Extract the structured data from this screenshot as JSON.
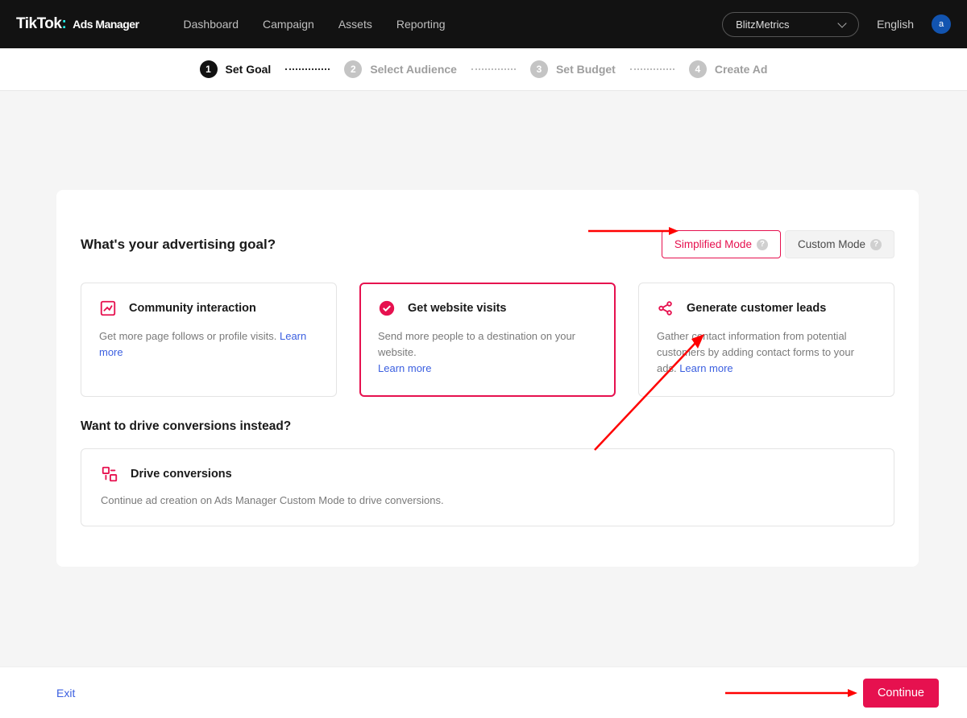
{
  "header": {
    "logo_main": "TikTok",
    "logo_colon": ":",
    "logo_sub": "Ads Manager",
    "nav": [
      "Dashboard",
      "Campaign",
      "Assets",
      "Reporting"
    ],
    "account": "BlitzMetrics",
    "language": "English",
    "avatar_letter": "a"
  },
  "steps": [
    {
      "num": "1",
      "label": "Set Goal",
      "active": true
    },
    {
      "num": "2",
      "label": "Select Audience",
      "active": false
    },
    {
      "num": "3",
      "label": "Set Budget",
      "active": false
    },
    {
      "num": "4",
      "label": "Create Ad",
      "active": false
    }
  ],
  "main": {
    "question": "What's your advertising goal?",
    "mode_simplified": "Simplified Mode",
    "mode_custom": "Custom Mode",
    "goals": [
      {
        "title": "Community interaction",
        "desc": "Get more page follows or profile visits. ",
        "learn_more": "Learn more"
      },
      {
        "title": "Get website visits",
        "desc": "Send more people to a destination on your website. ",
        "learn_more": "Learn more"
      },
      {
        "title": "Generate customer leads",
        "desc": "Gather contact information from potential customers by adding contact forms to your ads. ",
        "learn_more": "Learn more"
      }
    ],
    "subheading": "Want to drive conversions instead?",
    "conversions": {
      "title": "Drive conversions",
      "desc": "Continue ad creation on Ads Manager Custom Mode to drive conversions."
    }
  },
  "footer": {
    "exit": "Exit",
    "continue": "Continue"
  },
  "colors": {
    "brand_pink": "#e6114f",
    "link_blue": "#3b5fe0"
  }
}
